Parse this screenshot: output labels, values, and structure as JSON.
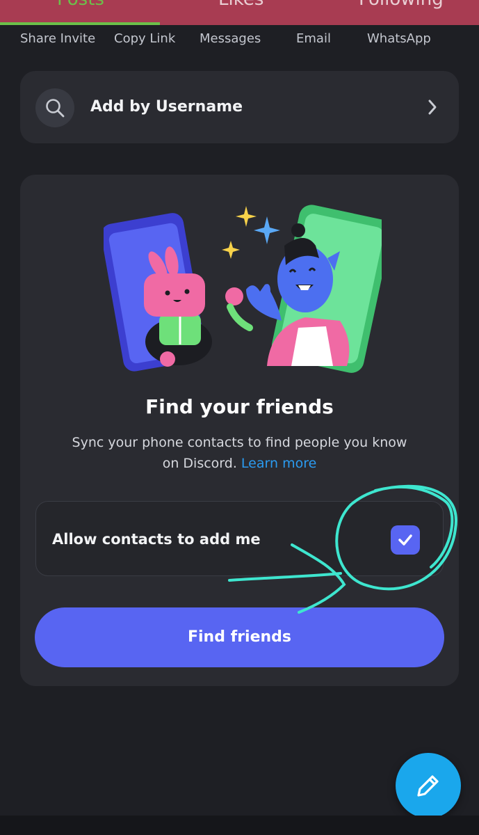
{
  "top_tabs": [
    {
      "label": "Posts"
    },
    {
      "label": "Likes"
    },
    {
      "label": "Following"
    }
  ],
  "share_options": [
    {
      "label": "Share Invite"
    },
    {
      "label": "Copy Link"
    },
    {
      "label": "Messages"
    },
    {
      "label": "Email"
    },
    {
      "label": "WhatsApp"
    }
  ],
  "add_by_username": {
    "label": "Add by Username",
    "icon": "search-icon"
  },
  "find_friends": {
    "title": "Find your friends",
    "description": "Sync your phone contacts to find people you know on Discord.",
    "learn_more": "Learn more",
    "allow_contacts_label": "Allow contacts to add me",
    "allow_contacts_checked": true,
    "button_label": "Find friends"
  },
  "fab": {
    "icon": "pencil-icon"
  },
  "colors": {
    "background": "#1e1f24",
    "card": "#2a2b31",
    "accent": "#5865f2",
    "link": "#2b9bf0",
    "annotation": "#3ee6cf",
    "fab": "#1aa7ec",
    "top_bar": "#a83c52",
    "active_tab": "#6cc04a"
  }
}
